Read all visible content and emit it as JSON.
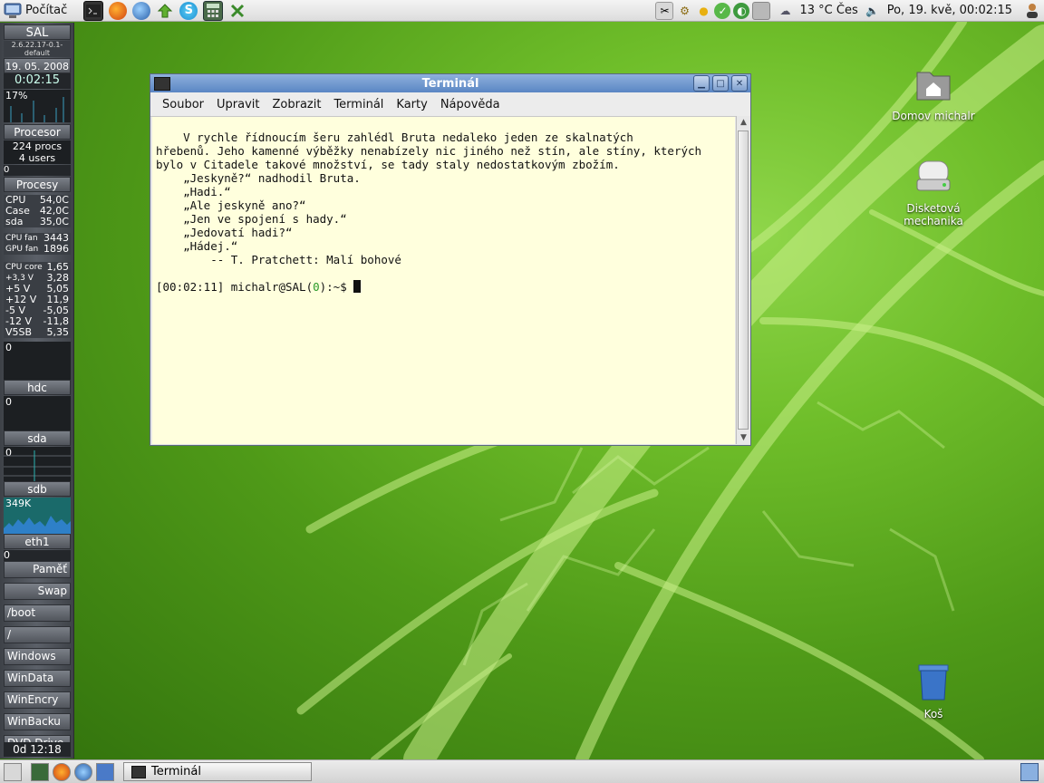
{
  "top_panel": {
    "menu_label": "Počítač",
    "launchers": [
      "terminal-icon",
      "firefox-icon",
      "thunderbird-icon",
      "software-update-icon",
      "skype-icon",
      "calculator-icon",
      "tools-icon"
    ],
    "weather": "13 °C Čes",
    "clock": "Po, 19. kvě, 00:02:15"
  },
  "sidebar": {
    "hostname": "SAL",
    "kernel": "2.6.22.17-0.1-default",
    "date": "19. 05. 2008",
    "uptime": "0:02:15",
    "cpu_percent": "17%",
    "cpu_label": "Procesor",
    "procs": "224 procs",
    "users": "4 users",
    "proc_zero": "0",
    "procs_label": "Procesy",
    "temps": [
      {
        "k": "CPU",
        "v": "54,0C"
      },
      {
        "k": "Case",
        "v": "42,0C"
      },
      {
        "k": "sda",
        "v": "35,0C"
      }
    ],
    "fans": [
      {
        "k": "CPU fan",
        "v": "3443"
      },
      {
        "k": "GPU fan",
        "v": "1896"
      }
    ],
    "volts": [
      {
        "k": "CPU core",
        "v": "1,65"
      },
      {
        "k": "+3,3 V",
        "v": "3,28"
      },
      {
        "k": "+5 V",
        "v": "5,05"
      },
      {
        "k": "+12 V",
        "v": "11,9"
      },
      {
        "k": "-5 V",
        "v": "-5,05"
      },
      {
        "k": "-12 V",
        "v": "-11,8"
      },
      {
        "k": "V5SB",
        "v": "5,35"
      }
    ],
    "disk_zero_1": "0",
    "disk1": "hdc",
    "disk_zero_2": "0",
    "disk2": "sda",
    "disk_zero_3": "0",
    "disk3": "sdb",
    "net_rate": "349K",
    "net_label": "eth1",
    "net_zero": "0",
    "mounts": [
      "Paměť",
      "Swap",
      "/boot",
      "/",
      "Windows",
      "WinData",
      "WinEncry",
      "WinBacku",
      "DVD Drive"
    ],
    "bottom": "0d 12:18"
  },
  "desktop_icons": {
    "home": "Domov michalr",
    "floppy": "Disketová mechanika",
    "trash": "Koš"
  },
  "terminal": {
    "title": "Terminál",
    "menu": [
      "Soubor",
      "Upravit",
      "Zobrazit",
      "Terminál",
      "Karty",
      "Nápověda"
    ],
    "lines": [
      "    V rychle řídnoucím šeru zahlédl Bruta nedaleko jeden ze skalnatých",
      "hřebenů. Jeho kamenné výběžky nenabízely nic jiného než stín, ale stíny, kterých",
      "bylo v Citadele takové množství, se tady staly nedostatkovým zbožím.",
      "    „Jeskyně?“ nadhodil Bruta.",
      "    „Hadi.“",
      "    „Ale jeskyně ano?“",
      "    „Jen ve spojení s hady.“",
      "    „Jedovatí hadi?“",
      "    „Hádej.“",
      "        -- T. Pratchett: Malí bohové",
      ""
    ],
    "prompt_time": "[00:02:11] michalr@SAL(",
    "prompt_code": "0",
    "prompt_tail": "):~$ "
  },
  "bottom_panel": {
    "task_label": "Terminál"
  }
}
